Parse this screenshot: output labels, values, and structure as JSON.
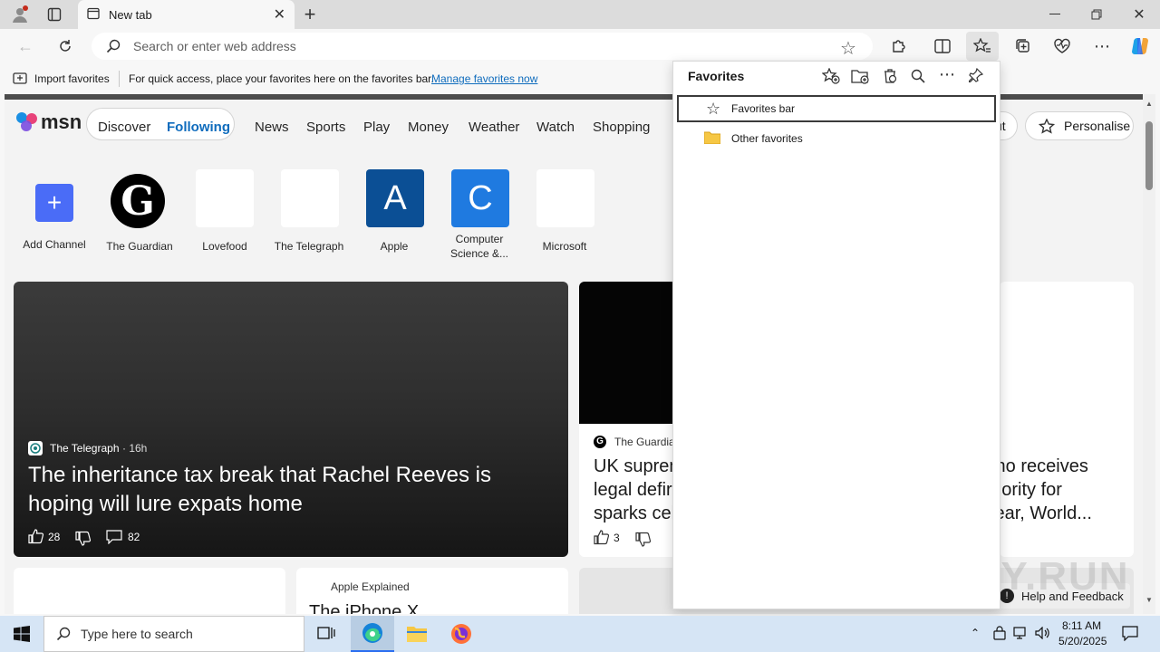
{
  "browser": {
    "tab_title": "New tab",
    "address_placeholder": "Search or enter web address"
  },
  "favorites_bar": {
    "import_label": "Import favorites",
    "hint": "For quick access, place your favorites here on the favorites bar.",
    "manage_link": "Manage favorites now"
  },
  "msn": {
    "logo": "msn",
    "tabs": [
      "Discover",
      "Following"
    ],
    "active_tab": "Following",
    "nav": [
      "News",
      "Sports",
      "Play",
      "Money",
      "Weather",
      "Watch",
      "Shopping"
    ],
    "partial_button": "ut",
    "personalise": "Personalise",
    "channels": [
      {
        "label": "Add Channel",
        "glyph": "+",
        "color": "#4a6cf7"
      },
      {
        "label": "The Guardian",
        "glyph": "G",
        "color": "#000000"
      },
      {
        "label": "Lovefood",
        "glyph": "",
        "color": "#ffffff"
      },
      {
        "label": "The Telegraph",
        "glyph": "",
        "color": "#ffffff"
      },
      {
        "label": "Apple",
        "glyph": "A",
        "color": "#0b4f95"
      },
      {
        "label": "Computer Science &...",
        "glyph": "C",
        "color": "#1f7ae0"
      },
      {
        "label": "Microsoft",
        "glyph": "",
        "color": "#ffffff"
      }
    ],
    "main_story": {
      "source": "The Telegraph",
      "age": "· 16h",
      "headline": "The inheritance tax break that Rachel Reeves is hoping will lure expats home",
      "likes": "28",
      "comments": "82"
    },
    "second_story": {
      "source": "The Guardia",
      "headline_lines": [
        "UK supren",
        "legal defir",
        "sparks cel"
      ],
      "likes": "3"
    },
    "third_story": {
      "headline_lines": [
        "ttino receives",
        "priority for",
        "clear, World..."
      ]
    },
    "bottom_story": {
      "source": "Apple Explained",
      "headline": "The iPhone X"
    },
    "help": "Help and Feedback"
  },
  "favorites_panel": {
    "title": "Favorites",
    "items": [
      {
        "label": "Favorites bar",
        "icon": "star-icon",
        "selected": true
      },
      {
        "label": "Other favorites",
        "icon": "folder-icon",
        "selected": false
      }
    ]
  },
  "taskbar": {
    "search_placeholder": "Type here to search",
    "time": "8:11 AM",
    "date": "5/20/2025"
  },
  "watermark": "ANY.RUN"
}
